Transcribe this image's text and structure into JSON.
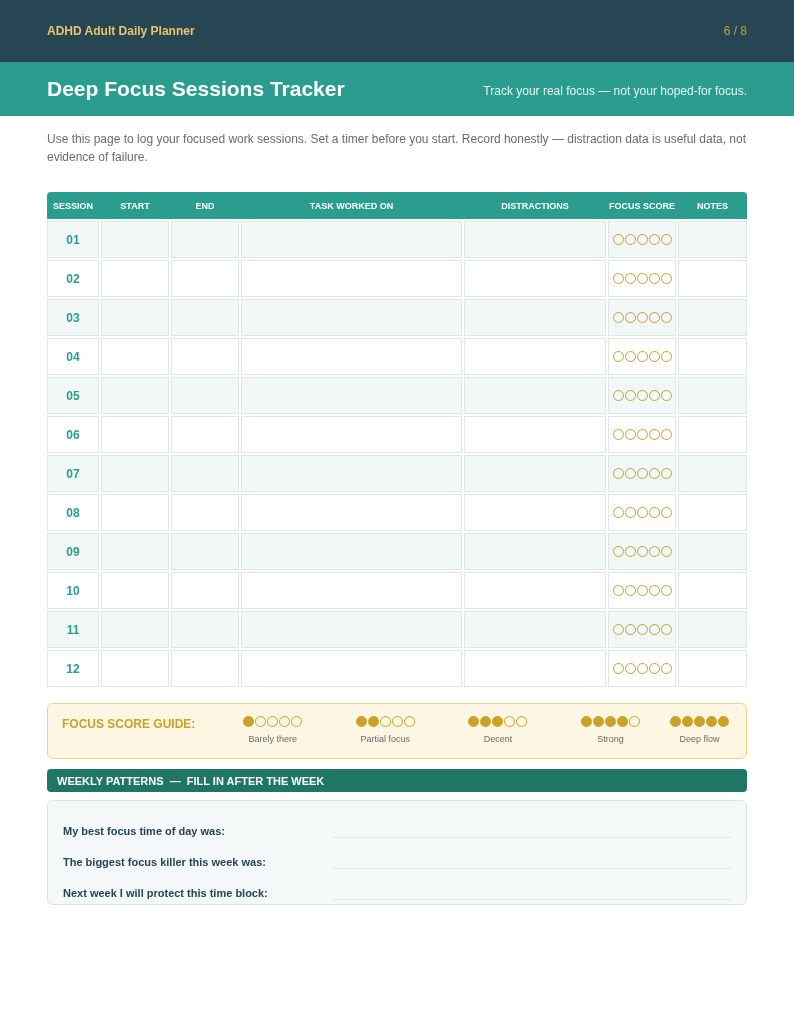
{
  "header": {
    "planner_title": "ADHD Adult Daily Planner",
    "page": "6 / 8"
  },
  "banner": {
    "title": "Deep Focus Sessions Tracker",
    "tagline": "Track your real focus — not your hoped-for focus."
  },
  "intro": "Use this page to log your focused work sessions. Set a timer before you start. Record honestly — distraction data is useful data, not evidence of failure.",
  "table": {
    "columns": [
      "SESSION",
      "START",
      "END",
      "TASK WORKED ON",
      "DISTRACTIONS",
      "FOCUS SCORE",
      "NOTES"
    ],
    "rows": [
      {
        "session": "01",
        "stars": 0
      },
      {
        "session": "02",
        "stars": 0
      },
      {
        "session": "03",
        "stars": 0
      },
      {
        "session": "04",
        "stars": 0
      },
      {
        "session": "05",
        "stars": 0
      },
      {
        "session": "06",
        "stars": 0
      },
      {
        "session": "07",
        "stars": 0
      },
      {
        "session": "08",
        "stars": 0
      },
      {
        "session": "09",
        "stars": 0
      },
      {
        "session": "10",
        "stars": 0
      },
      {
        "session": "11",
        "stars": 0
      },
      {
        "session": "12",
        "stars": 0
      }
    ]
  },
  "score_guide": {
    "title": "FOCUS SCORE GUIDE:",
    "levels": [
      {
        "stars": 1,
        "label": "Barely there"
      },
      {
        "stars": 2,
        "label": "Partial focus"
      },
      {
        "stars": 3,
        "label": "Decent"
      },
      {
        "stars": 4,
        "label": "Strong"
      },
      {
        "stars": 5,
        "label": "Deep flow"
      }
    ]
  },
  "weekly_patterns": {
    "title": "WEEKLY PATTERNS  —  FILL IN AFTER THE WEEK",
    "prompts": [
      "My best focus time of day was:",
      "The biggest focus killer this week was:",
      "Next week I will protect this time block:"
    ]
  }
}
